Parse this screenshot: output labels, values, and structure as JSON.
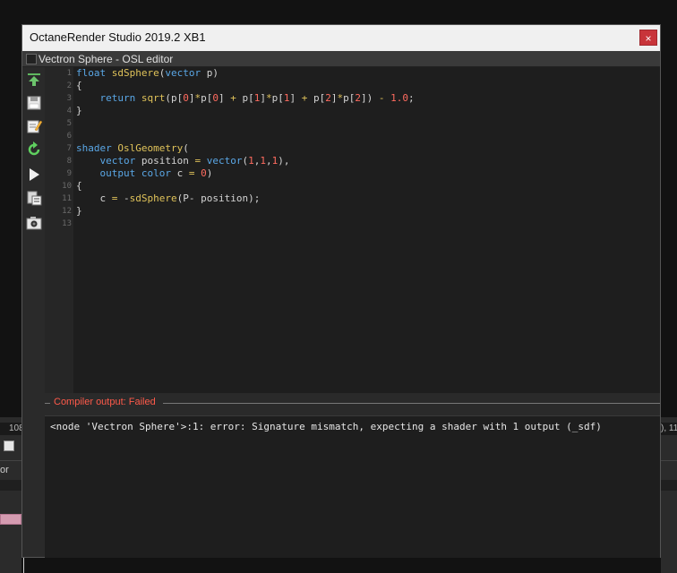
{
  "window": {
    "title": "OctaneRender Studio 2019.2 XB1",
    "close_label": "×"
  },
  "panel": {
    "title": "Vectron Sphere - OSL editor"
  },
  "toolbar": {
    "items": [
      {
        "icon": "upload-icon"
      },
      {
        "icon": "save-icon"
      },
      {
        "icon": "edit-icon"
      },
      {
        "icon": "refresh-icon"
      },
      {
        "icon": "play-icon"
      },
      {
        "icon": "clipboard-icon"
      },
      {
        "icon": "camera-icon"
      }
    ]
  },
  "editor": {
    "line_numbers": [
      "1",
      "2",
      "3",
      "4",
      "5",
      "6",
      "7",
      "8",
      "9",
      "10",
      "11",
      "12",
      "13"
    ]
  },
  "compiler": {
    "label": "Compiler output: Failed",
    "message": "<node 'Vectron Sphere'>:1: error: Signature mismatch, expecting a shader with 1 output (_sdf)"
  },
  "background": {
    "left_number": "108",
    "left_text": "or",
    "right_number": "), 11"
  },
  "colors": {
    "error": "#ff5a4a",
    "keyword": "#5aa7e6",
    "function": "#e0c35a",
    "number": "#ff6b5f",
    "close": "#c8343a"
  }
}
